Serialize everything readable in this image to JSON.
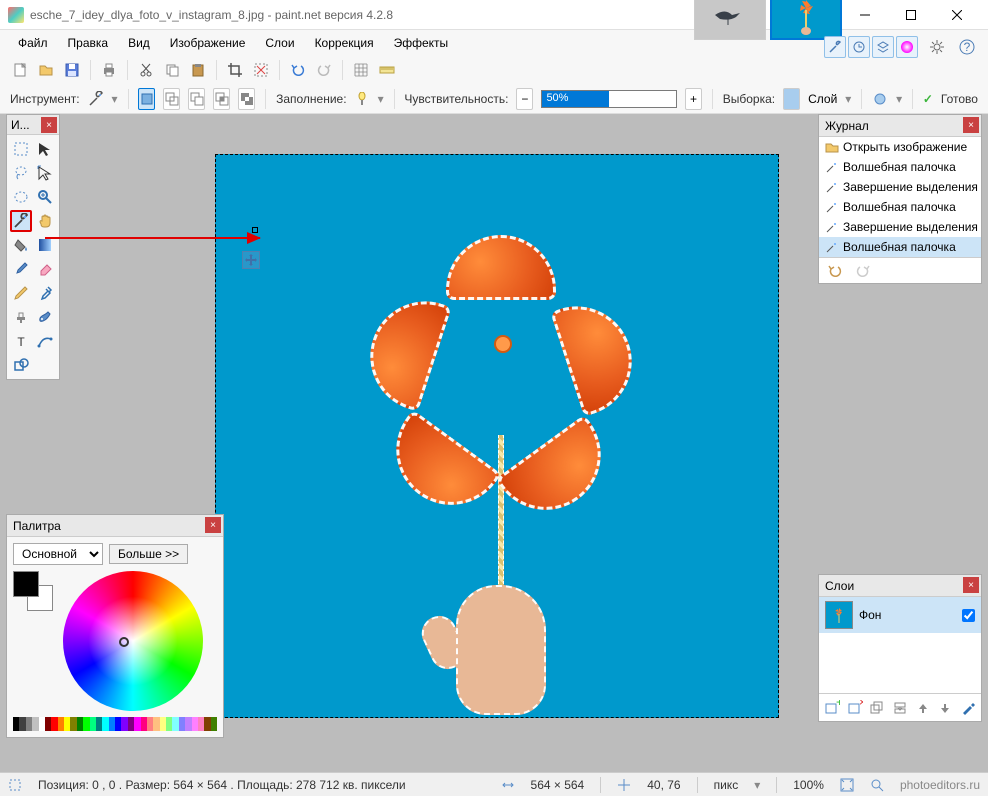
{
  "title": "esche_7_idey_dlya_foto_v_instagram_8.jpg - paint.net версия 4.2.8",
  "menu": [
    "Файл",
    "Правка",
    "Вид",
    "Изображение",
    "Слои",
    "Коррекция",
    "Эффекты"
  ],
  "tool_options": {
    "tool_label": "Инструмент:",
    "fill_label": "Заполнение:",
    "tolerance_label": "Чувствительность:",
    "tolerance_value": "50%",
    "sampling_label": "Выборка:",
    "sampling_value": "Слой",
    "finish_label": "Готово"
  },
  "tools_panel": {
    "title": "И..."
  },
  "history": {
    "title": "Журнал",
    "items": [
      "Открыть изображение",
      "Волшебная палочка",
      "Завершение выделения палочкой",
      "Волшебная палочка",
      "Завершение выделения палочкой",
      "Волшебная палочка"
    ]
  },
  "layers": {
    "title": "Слои",
    "layer_name": "Фон"
  },
  "palette": {
    "title": "Палитра",
    "primary": "Основной",
    "more": "Больше >>"
  },
  "status": {
    "pos": "Позиция: 0 , 0 . Размер: 564  × 564 . Площадь: 278 712 кв. пиксели",
    "dim": "564 × 564",
    "coord": "40, 76",
    "units": "пикс",
    "zoom": "100%"
  },
  "watermark": "photoeditors.ru",
  "palette_colors": [
    "#000",
    "#404040",
    "#808080",
    "#c0c0c0",
    "#fff",
    "#800000",
    "#f00",
    "#ff8000",
    "#ff0",
    "#808000",
    "#008000",
    "#0f0",
    "#00ff80",
    "#008080",
    "#0ff",
    "#0080ff",
    "#0000ff",
    "#8000ff",
    "#800080",
    "#f0f",
    "#ff0080",
    "#ff8080",
    "#ffc080",
    "#ffff80",
    "#80ff80",
    "#80ffff",
    "#8080ff",
    "#c080ff",
    "#ff80ff",
    "#ff80c0",
    "#804000",
    "#408000"
  ]
}
